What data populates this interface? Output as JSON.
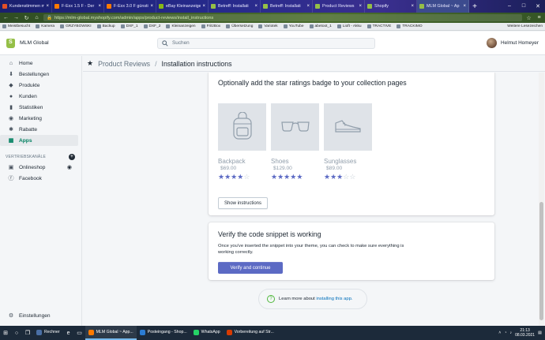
{
  "browser": {
    "tabs": [
      {
        "label": "Kundenstimmen m",
        "color": "#e34f26"
      },
      {
        "label": "F-Exx 1.5 F - Der",
        "color": "#ff7a00"
      },
      {
        "label": "F-Exx 3.0 F günsti",
        "color": "#ff7a00"
      },
      {
        "label": "eBay Kleinanzeige",
        "color": "#86b817"
      },
      {
        "label": "Betreff: Installati",
        "color": "#95bf47"
      },
      {
        "label": "Betreff: Installati",
        "color": "#95bf47"
      },
      {
        "label": "Product Reviews",
        "color": "#95bf47"
      },
      {
        "label": "Shopify",
        "color": "#95bf47"
      },
      {
        "label": "MLM Global ~ Ap",
        "color": "#95bf47"
      }
    ],
    "new_tab": "+",
    "url": "https://mlm-global.myshopify.com/admin/apps/product-reviews/install_instructions",
    "bookmarks": [
      "Meistbesucht",
      "Kamera",
      "GRZYBOWSKI",
      "Backup",
      "DXF_1",
      "DXF_2",
      "Kleinanzeigen",
      "FritzBox",
      "Übersetzung",
      "Variotek",
      "YouTube",
      "abetoot_1",
      "Lioft - Akku",
      "TRACTIVE",
      "TRACKIMO"
    ],
    "bookmarks_more": "Weitere Lesezeichen"
  },
  "topbar": {
    "store_name": "MLM Global",
    "search_placeholder": "Suchen",
    "user_name": "Helmut Homeyer"
  },
  "sidebar": {
    "items": [
      {
        "label": "Home",
        "icon": "home-icon"
      },
      {
        "label": "Bestellungen",
        "icon": "orders-icon"
      },
      {
        "label": "Produkte",
        "icon": "tag-icon"
      },
      {
        "label": "Kunden",
        "icon": "customers-icon"
      },
      {
        "label": "Statistiken",
        "icon": "analytics-icon"
      },
      {
        "label": "Marketing",
        "icon": "marketing-icon"
      },
      {
        "label": "Rabatte",
        "icon": "discount-icon"
      },
      {
        "label": "Apps",
        "icon": "apps-icon",
        "active": true
      }
    ],
    "channels_heading": "VERTRIEBSKANÄLE",
    "channels": [
      {
        "label": "Onlineshop",
        "icon": "store-icon"
      },
      {
        "label": "Facebook",
        "icon": "facebook-icon"
      }
    ],
    "settings_label": "Einstellungen"
  },
  "breadcrumb": {
    "parent": "Product Reviews",
    "separator": "/",
    "current": "Installation instructions"
  },
  "badge_card": {
    "title": "Optionally add the star ratings badge to your collection pages",
    "products": [
      {
        "name": "Backpack",
        "price": "$69.00",
        "rating": 4,
        "icon": "backpack-icon"
      },
      {
        "name": "Shoes",
        "price": "$129.00",
        "rating": 5,
        "icon": "sunglasses-icon"
      },
      {
        "name": "Sunglasses",
        "price": "$89.00",
        "rating": 3,
        "icon": "shoe-icon"
      }
    ],
    "show_instructions": "Show instructions"
  },
  "verify_card": {
    "title": "Verify the code snippet is working",
    "body": "Once you've inserted the snippet into your theme, you can check to make sure everything is working correctly.",
    "button": "Verify and continue"
  },
  "learn_more": {
    "text": "Learn more about ",
    "link": "installing this app."
  },
  "taskbar": {
    "apps": [
      {
        "label": "Rechner",
        "color": "#4a6fa5"
      },
      {
        "label": "MLM Global ~ App...",
        "color": "#ff7a00",
        "active": true
      },
      {
        "label": "Posteingang - Shop...",
        "color": "#2b7cd3"
      },
      {
        "label": "WhatsApp",
        "color": "#25d366"
      },
      {
        "label": "Vorbereitung auf Str...",
        "color": "#d83b01"
      }
    ],
    "time": "21:13",
    "date": "08.03.2021"
  },
  "colors": {
    "accent_green": "#008060",
    "primary_button": "#5c6ac4",
    "star": "#5c6ac4",
    "shopify_green": "#95bf47"
  }
}
